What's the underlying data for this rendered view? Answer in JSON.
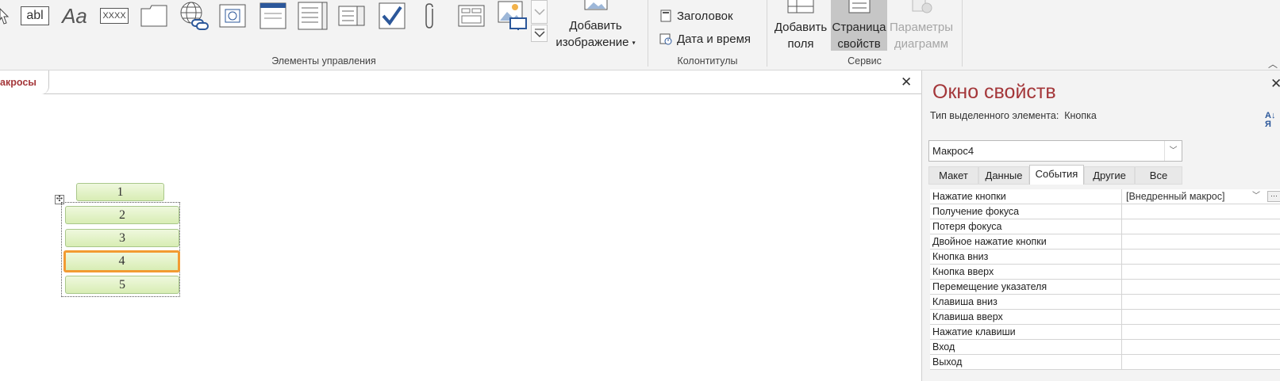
{
  "ribbon": {
    "groups": {
      "controls": "Элементы управления",
      "header_footer": "Колонтитулы",
      "tools": "Сервис"
    },
    "controls_icons": {
      "textbox_label": "abl",
      "label_label": "Aa",
      "button_label": "XXXX"
    },
    "insert_image": {
      "line1": "Добавить",
      "line2": "изображение"
    },
    "header_footer_items": {
      "title": "Заголовок",
      "date_time": "Дата и время"
    },
    "tools_items": {
      "add_fields_line1": "Добавить",
      "add_fields_line2": "поля",
      "property_sheet_line1": "Страница",
      "property_sheet_line2": "свойств",
      "chart_settings_line1": "Параметры",
      "chart_settings_line2": "диаграмм"
    }
  },
  "document": {
    "tab_label": "акросы",
    "buttons": [
      "1",
      "2",
      "3",
      "4",
      "5"
    ]
  },
  "property_sheet": {
    "title": "Окно свойств",
    "selection_type_label": "Тип выделенного элемента:",
    "selection_type_value": "Кнопка",
    "selected_object": "Макрос4",
    "tabs": [
      "Макет",
      "Данные",
      "События",
      "Другие",
      "Все"
    ],
    "active_tab": "События",
    "rows": [
      {
        "name": "Нажатие кнопки",
        "value": "[Внедренный макрос]"
      },
      {
        "name": "Получение фокуса",
        "value": ""
      },
      {
        "name": "Потеря фокуса",
        "value": ""
      },
      {
        "name": "Двойное нажатие кнопки",
        "value": ""
      },
      {
        "name": "Кнопка вниз",
        "value": ""
      },
      {
        "name": "Кнопка вверх",
        "value": ""
      },
      {
        "name": "Перемещение указателя",
        "value": ""
      },
      {
        "name": "Клавиша вниз",
        "value": ""
      },
      {
        "name": "Клавиша вверх",
        "value": ""
      },
      {
        "name": "Нажатие клавиши",
        "value": ""
      },
      {
        "name": "Вход",
        "value": ""
      },
      {
        "name": "Выход",
        "value": ""
      }
    ]
  },
  "colors": {
    "accent": "#a4373a",
    "selection_outline": "#f29b32",
    "button_fill": "#d8edb4"
  }
}
